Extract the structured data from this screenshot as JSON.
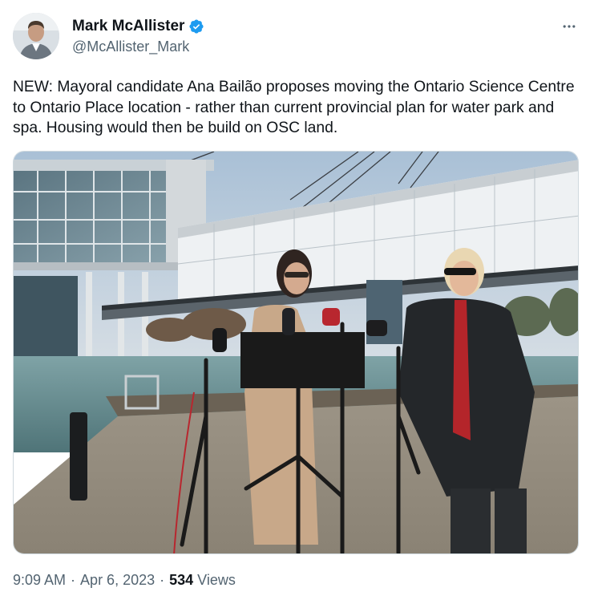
{
  "author": {
    "name": "Mark McAllister",
    "handle": "@McAllister_Mark",
    "verified": true,
    "avatar_icon": "person-avatar"
  },
  "tweet": {
    "text": "NEW: Mayoral candidate Ana Bailão proposes moving the Ontario Science Centre to Ontario Place location - rather than current provincial plan for water park and spa. Housing would then be build on OSC land."
  },
  "media": {
    "icon": "press-conference-photo"
  },
  "meta": {
    "time": "9:09 AM",
    "separator": "·",
    "date": "Apr 6, 2023",
    "views_count": "534",
    "views_label": "Views"
  },
  "colors": {
    "verified_blue": "#1d9bf0",
    "secondary_text": "#536471",
    "primary_text": "#0f1419"
  },
  "icons": {
    "more": "more-horizontal-icon",
    "verified": "verified-badge-icon"
  }
}
